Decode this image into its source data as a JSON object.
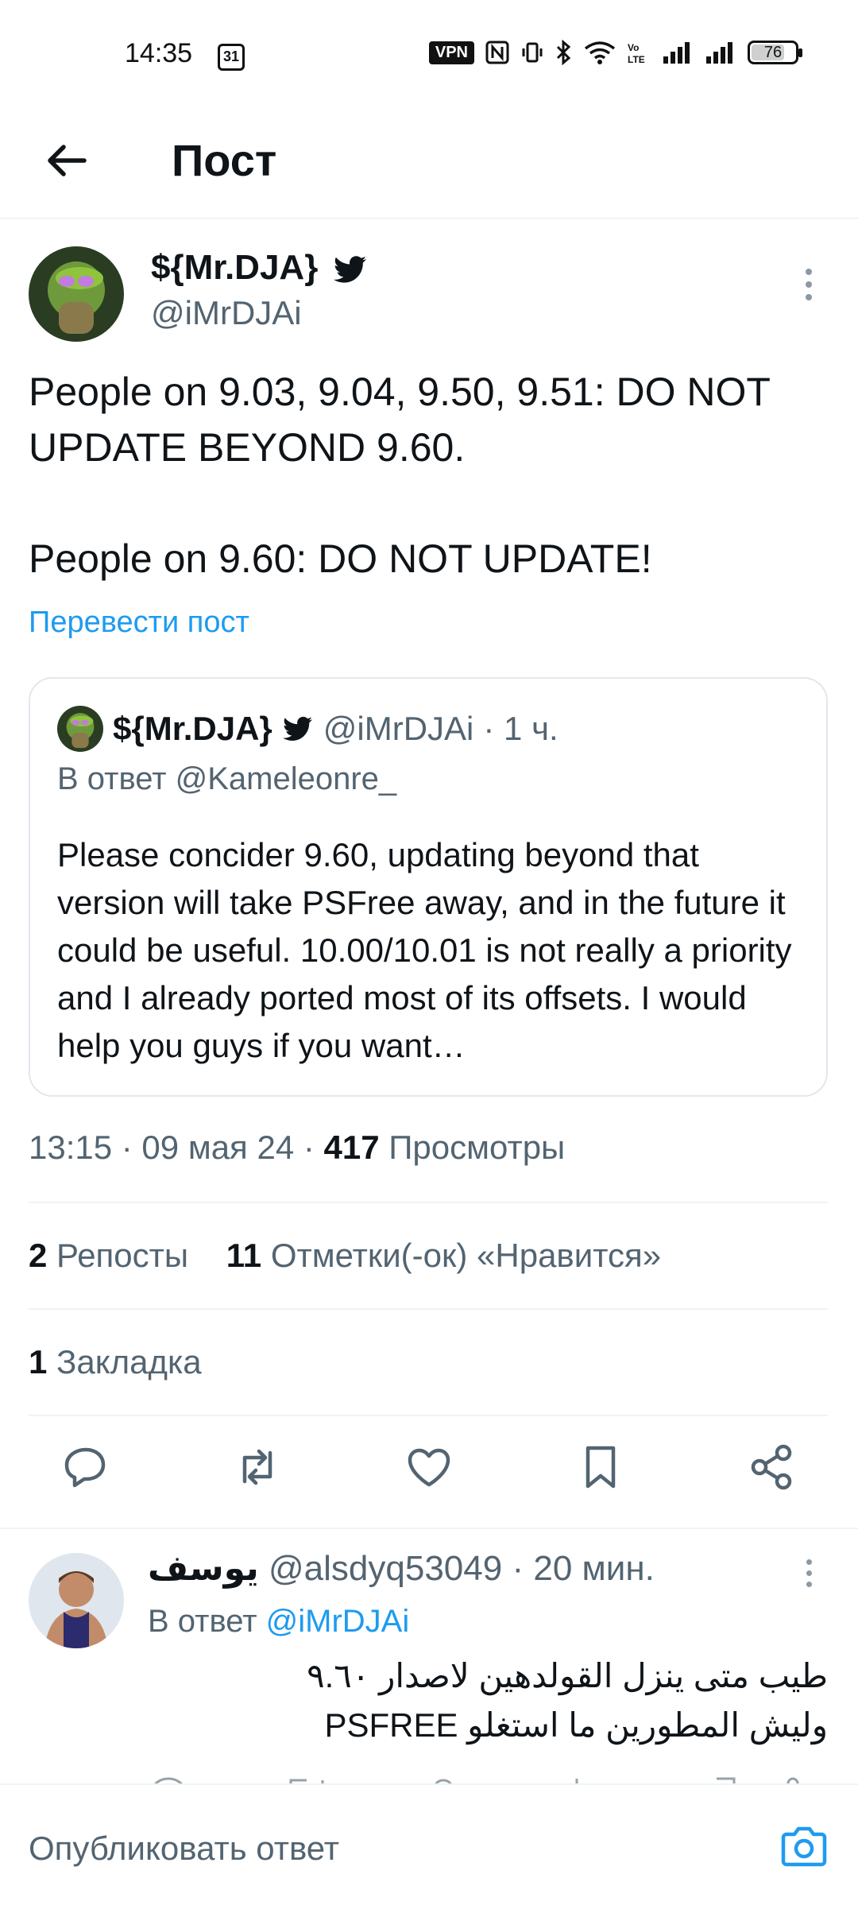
{
  "status_bar": {
    "time": "14:35",
    "calendar_day": "31",
    "vpn": "VPN",
    "battery": "76",
    "battery_fraction": 0.76
  },
  "header": {
    "title": "Пост"
  },
  "post": {
    "author_name": "${Mr.DJA}",
    "author_handle": "@iMrDJAi",
    "text_line1": "People on 9.03, 9.04, 9.50, 9.51: DO NOT UPDATE BEYOND 9.60.",
    "text_line2": "People on 9.60: DO NOT UPDATE!",
    "translate": "Перевести пост",
    "quote": {
      "author_name": "${Mr.DJA}",
      "author_handle": "@iMrDJAi",
      "time": "· 1 ч.",
      "reply_to": "В ответ @Kameleonre_",
      "text": "Please concider 9.60, updating beyond that version will take PSFree away, and in the future it could be useful. 10.00/10.01 is not really a priority and I already ported most of its offsets. I would help you guys if you want…"
    },
    "meta_time": "13:15 · 09 мая 24 · ",
    "views_count": "417",
    "views_label": " Просмотры",
    "reposts_count": "2",
    "reposts_label": " Репосты",
    "likes_count": "11",
    "likes_label": " Отметки(-ок) «Нравится»",
    "bookmarks_count": "1",
    "bookmarks_label": " Закладка"
  },
  "reply": {
    "author_name": "يوسف",
    "author_handle": "@alsdyq53049",
    "time": "· 20 мин.",
    "reply_to_prefix": "В ответ ",
    "reply_to_link": "@iMrDJAi",
    "text_line1": "طيب متى ينزل القولدهين لاصدار ٩.٦٠",
    "text_line2": "وليش المطورين ما استغلو PSFREE"
  },
  "compose": {
    "placeholder": "Опубликовать ответ"
  },
  "colors": {
    "accent": "#1d9bf0",
    "secondary_text": "#536471",
    "divider": "#eff3f4"
  }
}
